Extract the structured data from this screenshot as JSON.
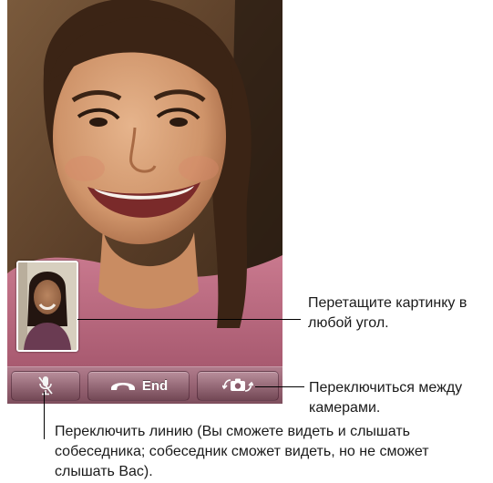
{
  "call_screen": {
    "remote_video": "remote-caller-video",
    "local_preview": "self-view-preview",
    "controls": {
      "mute_icon": "mute-microphone-icon",
      "end_label": "End",
      "end_icon": "handset-icon",
      "switch_camera_icon": "switch-camera-icon"
    }
  },
  "callouts": {
    "drag_preview": "Перетащите картинку в любой угол.",
    "switch_cameras": "Переключиться между камерами.",
    "mute_line": "Переключить линию (Вы сможете видеть и слышать собеседника; собеседник сможет видеть, но не сможет слышать Вас)."
  },
  "colors": {
    "control_bar": "#9a6676",
    "callout_text": "#1a1a1a",
    "leader_line": "#000000"
  }
}
